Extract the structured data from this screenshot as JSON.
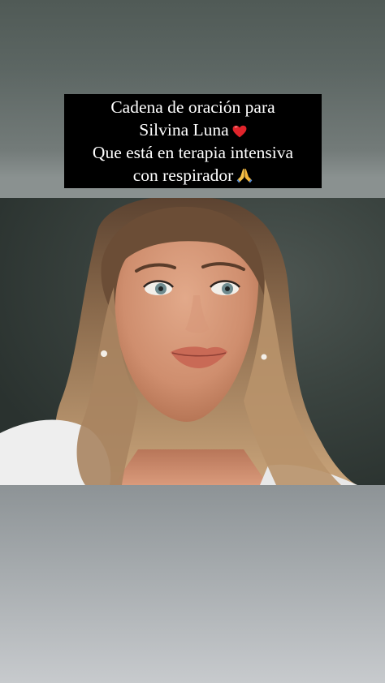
{
  "story": {
    "caption_lines": [
      "Cadena de oración para",
      "Silvina Luna",
      "Que está en terapia intensiva",
      "con respirador"
    ],
    "emojis": {
      "line2": "red-heart-icon",
      "line4": "praying-hands-icon"
    }
  },
  "photo": {
    "subject": "woman-portrait"
  },
  "colors": {
    "caption_bg": "#000000",
    "caption_text": "#ffffff",
    "top_bg": "#5c6663",
    "bottom_bg": "#a4a9ac"
  }
}
